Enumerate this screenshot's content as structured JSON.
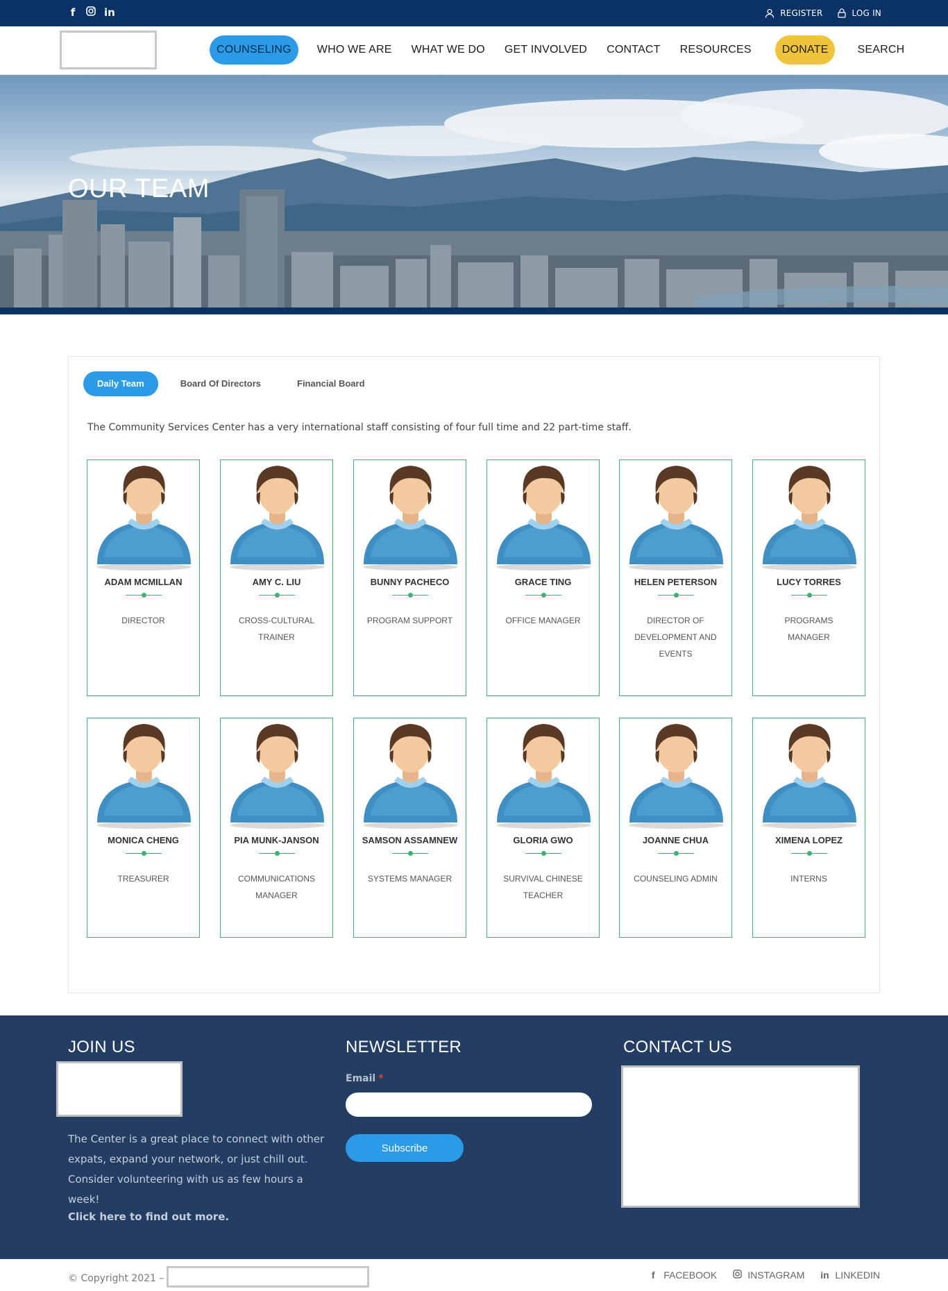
{
  "topbar": {
    "social_icons": [
      "facebook-icon",
      "instagram-icon",
      "linkedin-icon"
    ],
    "register_label": "REGISTER",
    "login_label": "LOG IN"
  },
  "nav": {
    "items": [
      {
        "label": "COUNSELING",
        "style": "pill-blue"
      },
      {
        "label": "WHO WE ARE"
      },
      {
        "label": "WHAT WE DO"
      },
      {
        "label": "GET INVOLVED"
      },
      {
        "label": "CONTACT"
      },
      {
        "label": "RESOURCES"
      },
      {
        "label": "DONATE",
        "style": "pill-yellow"
      },
      {
        "label": "SEARCH"
      }
    ]
  },
  "hero": {
    "title": "OUR TEAM"
  },
  "team": {
    "tabs": [
      "Daily Team",
      "Board Of Directors",
      "Financial Board"
    ],
    "active_tab": "Daily Team",
    "intro": "The Community Services Center has a very international staff consisting of four full time and 22 part-time staff.",
    "members": [
      {
        "name": "ADAM MCMILLAN",
        "role": "DIRECTOR"
      },
      {
        "name": "AMY C. LIU",
        "role": "CROSS-CULTURAL TRAINER"
      },
      {
        "name": "BUNNY PACHECO",
        "role": "PROGRAM SUPPORT"
      },
      {
        "name": "GRACE TING",
        "role": "OFFICE MANAGER"
      },
      {
        "name": "HELEN PETERSON",
        "role": "DIRECTOR OF DEVELOPMENT AND EVENTS"
      },
      {
        "name": "LUCY TORRES",
        "role": "PROGRAMS MANAGER"
      },
      {
        "name": "MONICA CHENG",
        "role": "TREASURER"
      },
      {
        "name": "PIA MUNK-JANSON",
        "role": "COMMUNICATIONS MANAGER"
      },
      {
        "name": "SAMSON ASSAMNEW",
        "role": "SYSTEMS MANAGER"
      },
      {
        "name": "GLORIA GWO",
        "role": "SURVIVAL CHINESE TEACHER"
      },
      {
        "name": "JOANNE CHUA",
        "role": "COUNSELING ADMIN"
      },
      {
        "name": "XIMENA LOPEZ",
        "role": "INTERNS"
      }
    ]
  },
  "footer": {
    "join": {
      "title": "JOIN US",
      "text": "The Center is a great place to connect with other expats, expand your network, or just chill out. Consider volunteering with us as few hours a week!",
      "link": "Click here to find out more."
    },
    "newsletter": {
      "title": "NEWSLETTER",
      "email_label": "Email",
      "required_mark": "*",
      "email_value": "",
      "button": "Subscribe"
    },
    "contact": {
      "title": "CONTACT US"
    }
  },
  "bottombar": {
    "copyright": "© Copyright 2021 –",
    "links": [
      {
        "label": "FACEBOOK",
        "icon": "facebook-icon"
      },
      {
        "label": "INSTAGRAM",
        "icon": "instagram-icon"
      },
      {
        "label": "LINKEDIN",
        "icon": "linkedin-icon"
      }
    ]
  },
  "colors": {
    "topbar": "#0b3264",
    "accent_blue": "#2b9be8",
    "accent_yellow": "#f0c43a",
    "card_border": "#3cb371",
    "footer": "#243d63"
  }
}
